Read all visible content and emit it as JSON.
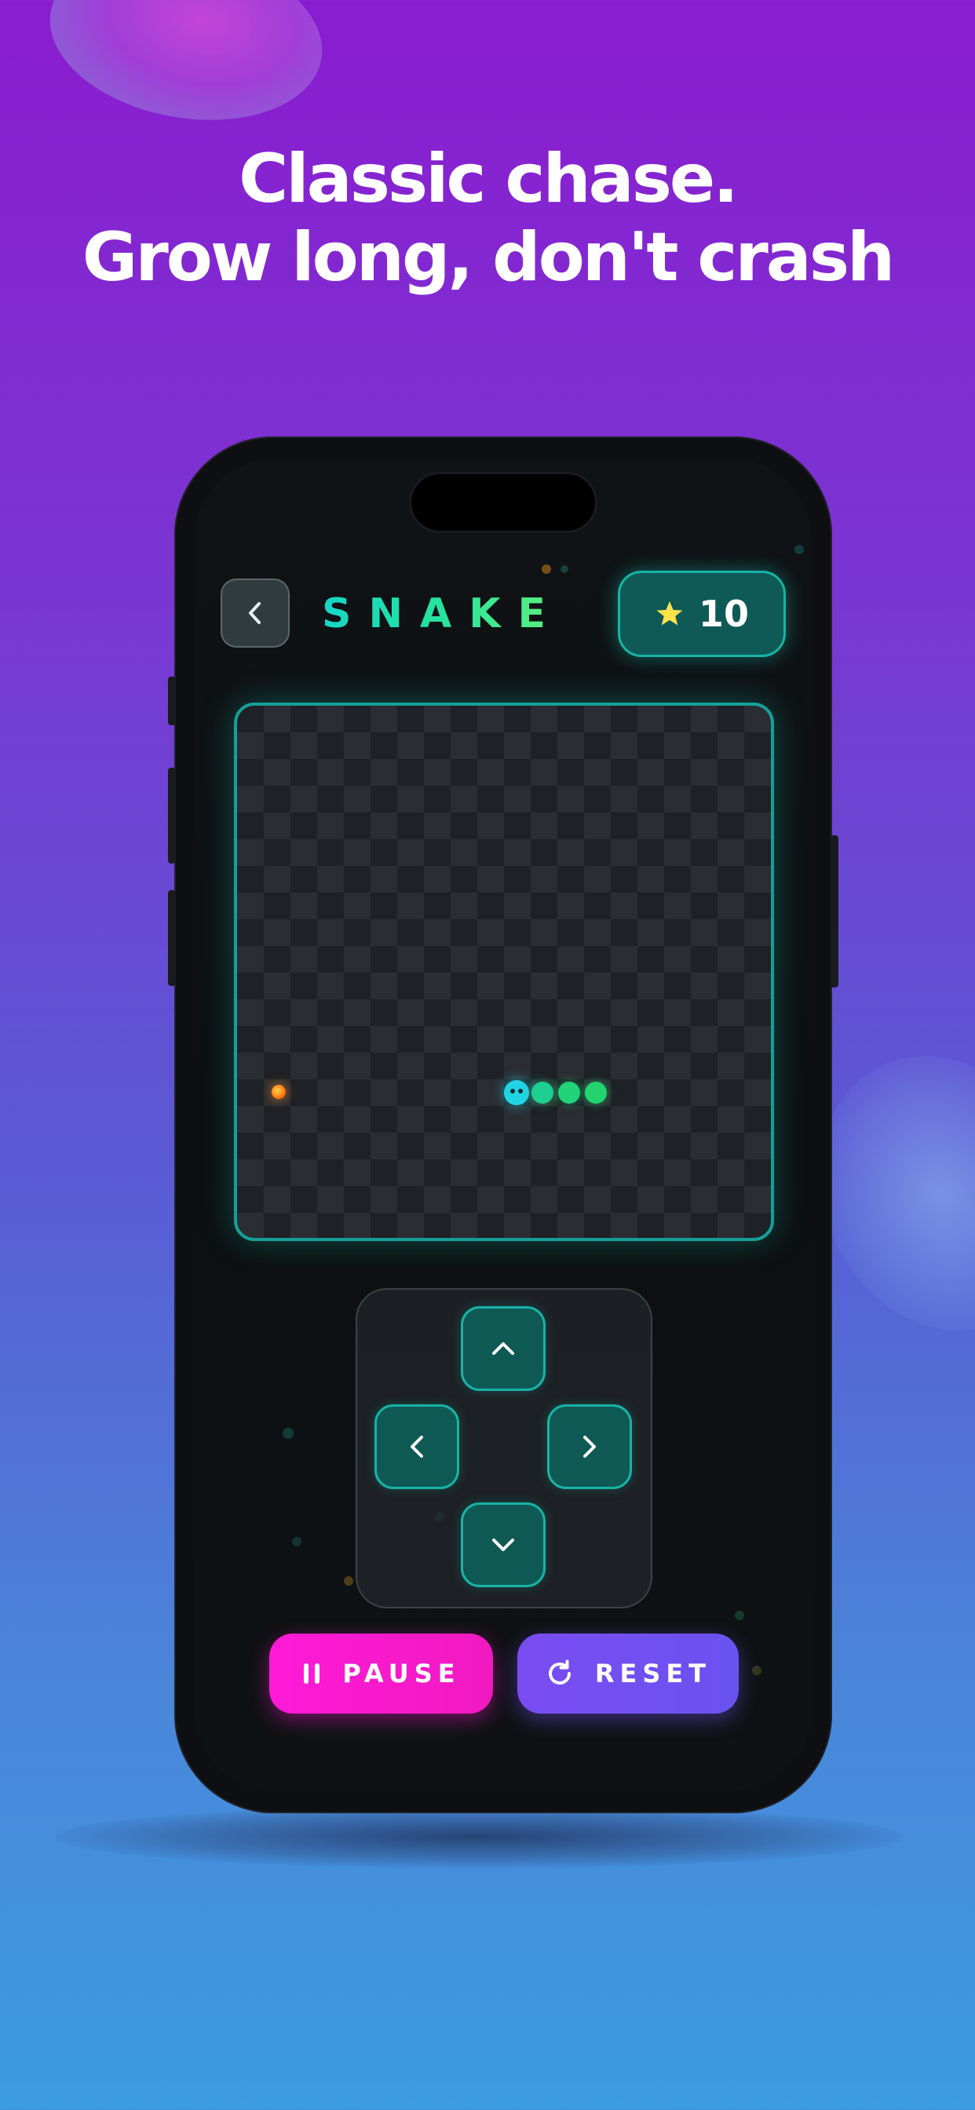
{
  "headline": {
    "line1": "Classic chase.",
    "line2": "Grow long, don't crash"
  },
  "game": {
    "title": "SNAKE",
    "score": "10",
    "score_icon": "star-icon",
    "back_icon": "chevron-left-icon"
  },
  "controls": {
    "up_icon": "chevron-up-icon",
    "down_icon": "chevron-down-icon",
    "left_icon": "chevron-left-icon",
    "right_icon": "chevron-right-icon",
    "pause_label": "PAUSE",
    "reset_label": "RESET",
    "pause_icon": "pause-icon",
    "reset_icon": "reset-icon"
  },
  "colors": {
    "accent": "#18b3a6",
    "pause": "#ff1ad8",
    "reset": "#7a4cf2",
    "snake_head": "#22d3e6",
    "snake_body": "#22d37a",
    "food": "#ff8a1a",
    "star": "#ffe24a"
  }
}
